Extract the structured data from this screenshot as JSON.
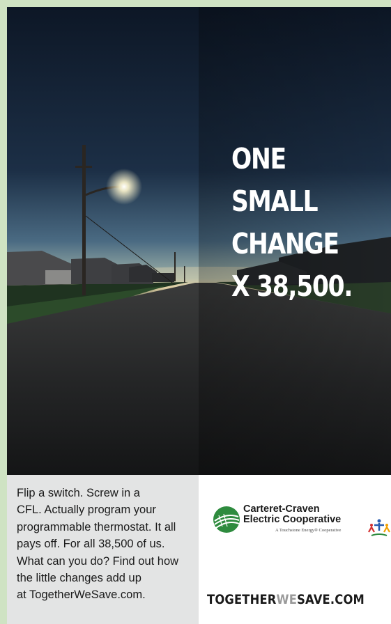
{
  "headline": {
    "line1": "ONE",
    "line2": "SMALL",
    "line3": "CHANGE",
    "line4": "X 38,500."
  },
  "body_copy": {
    "line1": "Flip a switch. Screw in a",
    "line2": "CFL. Actually program your",
    "line3": "programmable thermostat. It all",
    "line4": "pays off. For all 38,500 of us.",
    "line5": "What can you do? Find out how",
    "line6": "the little changes add up",
    "line7": "at TogetherWeSave.com."
  },
  "logo": {
    "name_line1": "Carteret-Craven",
    "name_line2": "Electric Cooperative",
    "tagline": "A Touchstone Energy® Cooperative"
  },
  "website": {
    "part1": "TOGETHER",
    "part2": "WE",
    "part3": "SAVE.COM"
  },
  "colors": {
    "frame": "#cfe3c3",
    "panel_left": "#e3e4e4",
    "panel_right": "#ffffff",
    "headline": "#ffffff",
    "logo_green": "#2e8b3e"
  }
}
